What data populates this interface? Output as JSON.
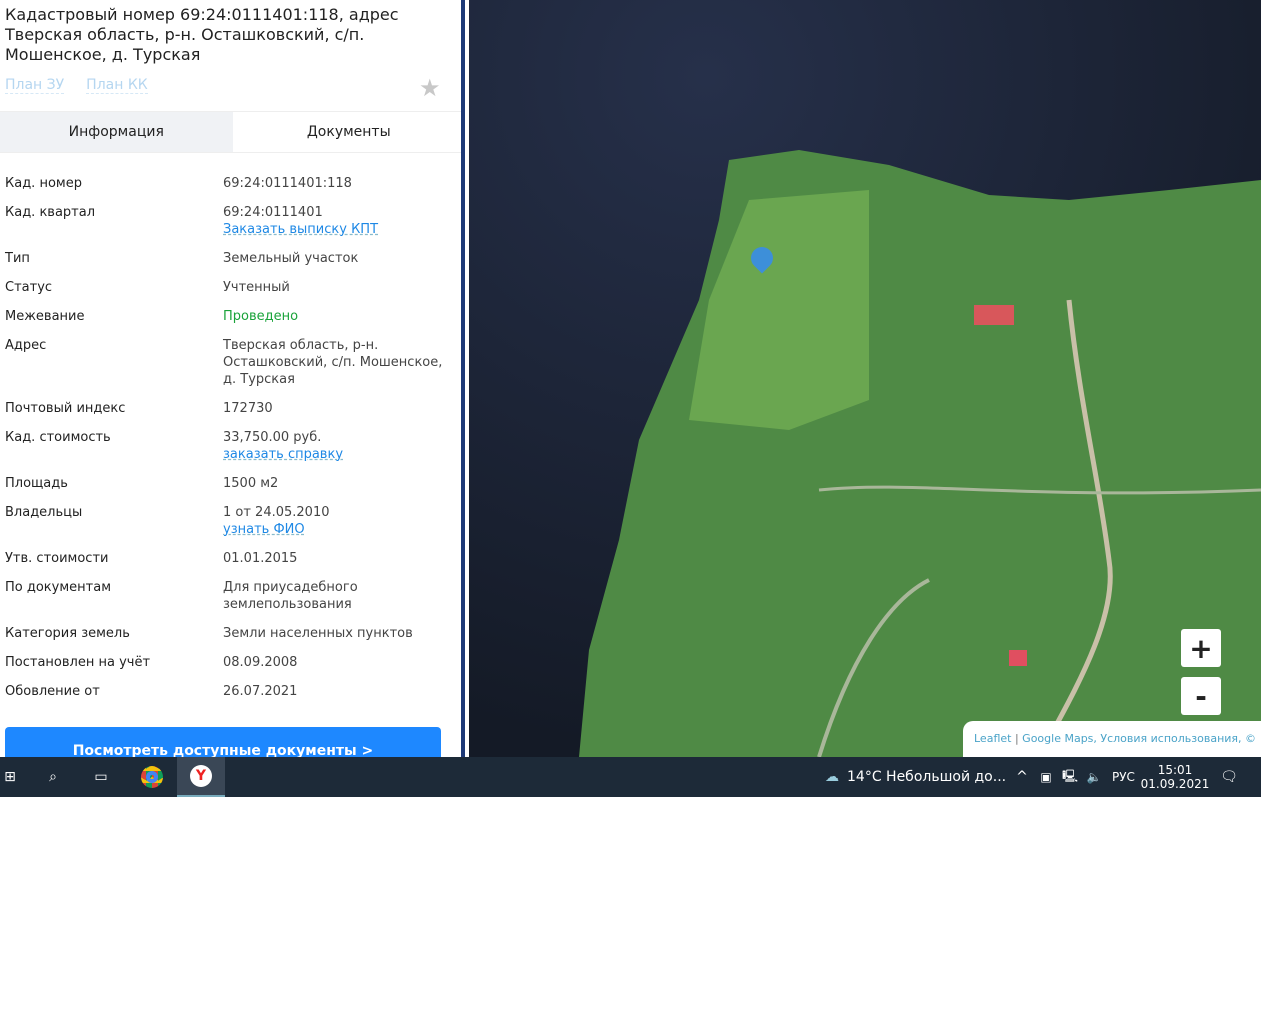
{
  "panel": {
    "title": "Кадастровый номер 69:24:0111401:118, адрес Тверская область, р-н. Осташковский, с/п. Мошенское, д. Турская",
    "plan_zu": "План ЗУ",
    "plan_kk": "План КК",
    "tabs": [
      "Информация",
      "Документы"
    ],
    "rows": [
      {
        "k": "Кад. номер",
        "v": "69:24:0111401:118"
      },
      {
        "k": "Кад. квартал",
        "v": "69:24:0111401",
        "link": "Заказать выписку КПТ"
      },
      {
        "k": "Тип",
        "v": "Земельный участок"
      },
      {
        "k": "Статус",
        "v": "Учтенный"
      },
      {
        "k": "Межевание",
        "v": "Проведено"
      },
      {
        "k": "Адрес",
        "v": "Тверская область, р-н. Осташковский, с/п. Мошенское, д. Турская"
      },
      {
        "k": "Почтовый индекс",
        "v": "172730"
      },
      {
        "k": "Кад. стоимость",
        "v": "33,750.00 руб.",
        "link": "заказать справку"
      },
      {
        "k": "Площадь",
        "v": "1500 м2"
      },
      {
        "k": "Владельцы",
        "v": "1 от 24.05.2010",
        "link": "узнать ФИО"
      },
      {
        "k": "Утв. стоимости",
        "v": "01.01.2015"
      },
      {
        "k": "По документам",
        "v": "Для приусадебного землепользования"
      },
      {
        "k": "Категория земель",
        "v": "Земли населенных пунктов"
      },
      {
        "k": "Постановлен на учёт",
        "v": "08.09.2008"
      },
      {
        "k": "Обовление от",
        "v": "26.07.2021"
      }
    ],
    "button": "Посмотреть доступные документы >"
  },
  "map": {
    "zoom_in": "+",
    "zoom_out": "-",
    "attr_leaflet": "Leaflet",
    "attr_sep": "|",
    "attr_rest": "Google Maps, Условия использования, ©"
  },
  "taskbar": {
    "weather": "14°C  Небольшой до...",
    "lang": "РУС",
    "time": "15:01",
    "date": "01.09.2021"
  }
}
